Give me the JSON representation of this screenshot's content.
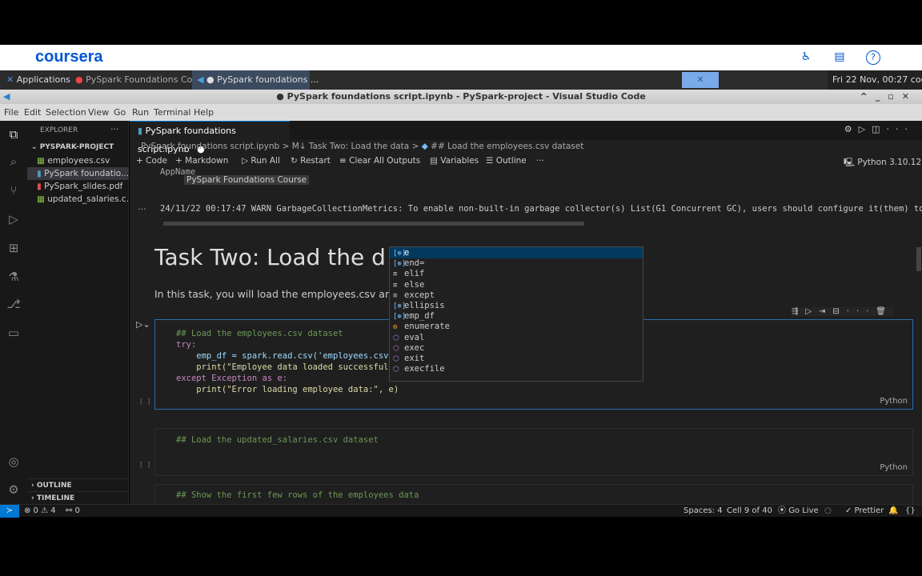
{
  "coursera": {
    "logo": "coursera",
    "icons": [
      "accessibility-icon",
      "notes-icon",
      "help-icon"
    ]
  },
  "taskbar": {
    "applications": "Applications",
    "tab1": "PySpark Foundations Co...",
    "tab2": "● PySpark foundations ...",
    "clock": "Fri 22 Nov, 00:27",
    "user": "coder"
  },
  "window": {
    "title": "● PySpark foundations script.ipynb - PySpark-project - Visual Studio Code"
  },
  "menu": [
    "File",
    "Edit",
    "Selection",
    "View",
    "Go",
    "Run",
    "Terminal",
    "Help"
  ],
  "explorer": {
    "title": "EXPLORER",
    "project": "PYSPARK-PROJECT",
    "files": [
      "employees.csv",
      "PySpark foundatio...",
      "PySpark_slides.pdf",
      "updated_salaries.c..."
    ],
    "outline": "OUTLINE",
    "timeline": "TIMELINE",
    "badge": "1"
  },
  "editor": {
    "tab": "PySpark foundations script.ipynb",
    "breadcrumb": [
      "PySpark foundations script.ipynb",
      ">",
      "M↓ Task Two: Load the data",
      ">",
      "## Load the employees.csv dataset"
    ],
    "toolbar": [
      "+ Code",
      "+ Markdown",
      "Run All",
      "Restart",
      "Clear All Outputs",
      "Variables",
      "Outline",
      "···"
    ],
    "kernel": "Python 3.10.12"
  },
  "notebook": {
    "output_label": "AppName",
    "output_value": "PySpark Foundations Course",
    "warn": "24/11/22 00:17:47 WARN GarbageCollectionMetrics: To enable non-built-in garbage collector(s) List(G1 Concurrent GC), users should configure it(them) to",
    "heading": "Task Two: Load the d",
    "para": "In this task, you will load the employees.csv an",
    "cell1": [
      "## Load the employees.csv dataset",
      "try:",
      "    emp_df = spark.read.csv('employees.csv'",
      "    print(\"Employee data loaded successfull",
      "except Exception as e:",
      "    print(\"Error loading employee data:\", e)"
    ],
    "cell2": "## Load the updated_salaries.csv dataset",
    "cell3": "## Show the first few rows of the employees data",
    "lang": "Python",
    "exec": "[ ]"
  },
  "suggestions": [
    {
      "label": "e",
      "kind": "variable"
    },
    {
      "label": "end=",
      "kind": "variable"
    },
    {
      "label": "elif",
      "kind": "keyword"
    },
    {
      "label": "else",
      "kind": "keyword"
    },
    {
      "label": "except",
      "kind": "keyword"
    },
    {
      "label": "ellipsis",
      "kind": "variable"
    },
    {
      "label": "emp_df",
      "kind": "variable"
    },
    {
      "label": "enumerate",
      "kind": "class"
    },
    {
      "label": "eval",
      "kind": "function"
    },
    {
      "label": "exec",
      "kind": "function"
    },
    {
      "label": "exit",
      "kind": "function"
    },
    {
      "label": "execfile",
      "kind": "function"
    }
  ],
  "status": {
    "errors": "⊗ 0 ⚠ 4",
    "ports": "⚯ 0",
    "spaces": "Spaces: 4",
    "cell": "Cell 9 of 40",
    "golive": "Go Live",
    "prettier": "✓ Prettier"
  }
}
